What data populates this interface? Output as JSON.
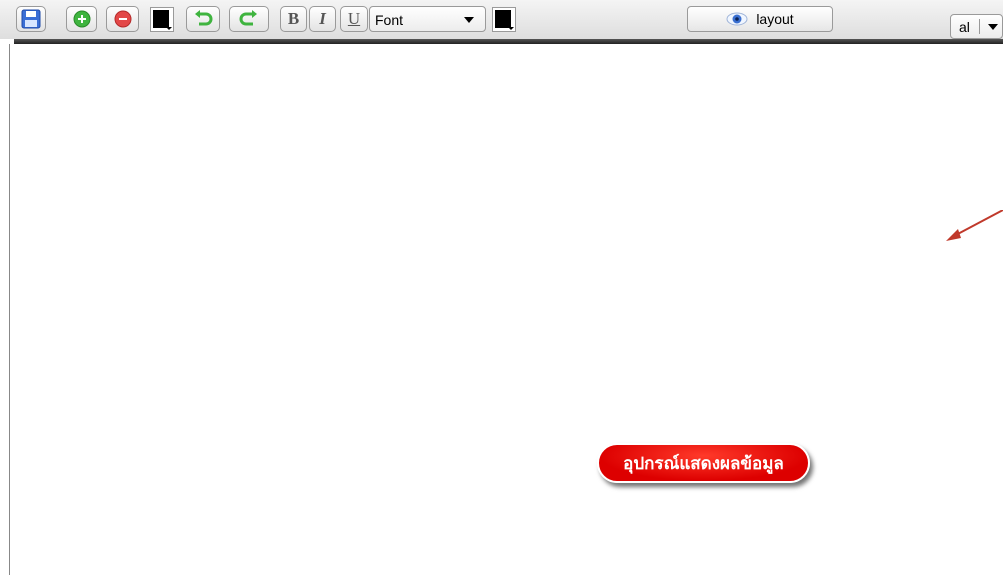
{
  "toolbar": {
    "icons": [
      "save-icon",
      "add-icon",
      "remove-icon",
      "fill-color-icon",
      "undo-icon",
      "redo-icon"
    ],
    "bold_label": "B",
    "italic_label": "I",
    "underline_label": "U",
    "font_select": {
      "value": "Font"
    },
    "text_color": "#000000",
    "fill_color": "#000000",
    "layout_button": {
      "label": "layout",
      "icon": "eye-icon"
    },
    "align_select": {
      "value": "al"
    }
  },
  "canvas": {
    "badge_label": "อุปกรณ์แสดงผลข้อมูล",
    "badge_color": "#e00000",
    "arrow_color": "#c0392b"
  }
}
